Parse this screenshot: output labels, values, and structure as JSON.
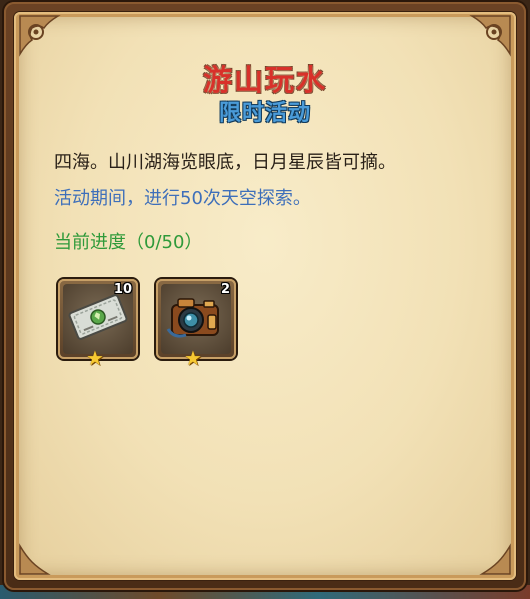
{
  "dialog": {
    "title": "游山玩水",
    "subtitle": "限时活动",
    "description": "四海。山川湖海览眼底，日月星辰皆可摘。",
    "activity_period": "活动期间，进行50次天空探索。",
    "progress_text": "当前进度（0/50）"
  },
  "rewards": [
    {
      "icon": "ticket-icon",
      "count": "10",
      "stars": 1
    },
    {
      "icon": "camera-icon",
      "count": "2",
      "stars": 1
    }
  ],
  "colors": {
    "title": "#d8312a",
    "subtitle": "#4a9bd8",
    "period_text": "#3e6fba",
    "progress_text": "#2f9a3a",
    "star": "#f7c932"
  }
}
